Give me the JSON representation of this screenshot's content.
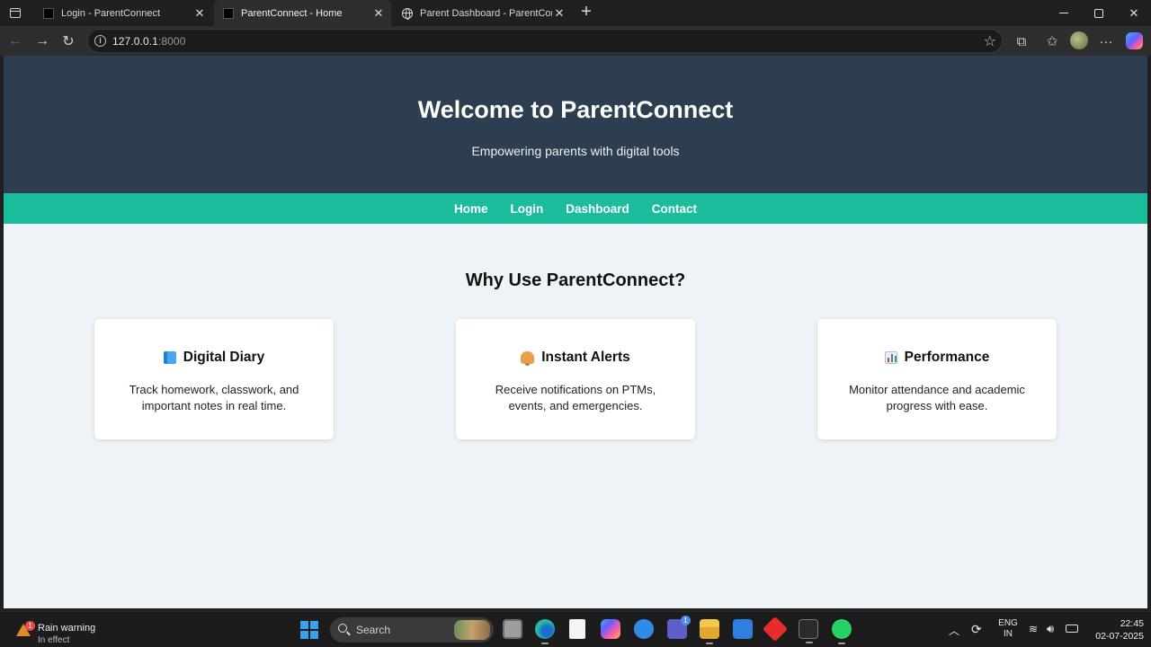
{
  "browser": {
    "tabs": [
      {
        "title": "Login - ParentConnect",
        "favicon": "black-square-icon",
        "active": false
      },
      {
        "title": "ParentConnect - Home",
        "favicon": "black-square-icon",
        "active": true
      },
      {
        "title": "Parent Dashboard - ParentConnect",
        "favicon": "globe-icon",
        "active": false
      }
    ],
    "new_tab": "+",
    "url_host": "127.0.0.1",
    "url_port": ":8000"
  },
  "page": {
    "hero": {
      "title": "Welcome to ParentConnect",
      "subtitle": "Empowering parents with digital tools"
    },
    "nav": [
      "Home",
      "Login",
      "Dashboard",
      "Contact"
    ],
    "section_title": "Why Use ParentConnect?",
    "features": [
      {
        "icon": "blue-book-icon",
        "title": "Digital Diary",
        "description": "Track homework, classwork, and important notes in real time."
      },
      {
        "icon": "bell-icon",
        "title": "Instant Alerts",
        "description": "Receive notifications on PTMs, events, and emergencies."
      },
      {
        "icon": "bar-chart-icon",
        "title": "Performance",
        "description": "Monitor attendance and academic progress with ease."
      }
    ],
    "colors": {
      "hero_bg": "#2c3e50",
      "nav_bg": "#1abc9c",
      "page_bg": "#eef3f7",
      "card_bg": "#ffffff"
    }
  },
  "taskbar": {
    "weather_badge": "1",
    "weather_title": "Rain warning",
    "weather_status": "In effect",
    "search_placeholder": "Search",
    "teams_badge": "1",
    "lang_top": "ENG",
    "lang_bottom": "IN",
    "time": "22:45",
    "date": "02-07-2025"
  }
}
